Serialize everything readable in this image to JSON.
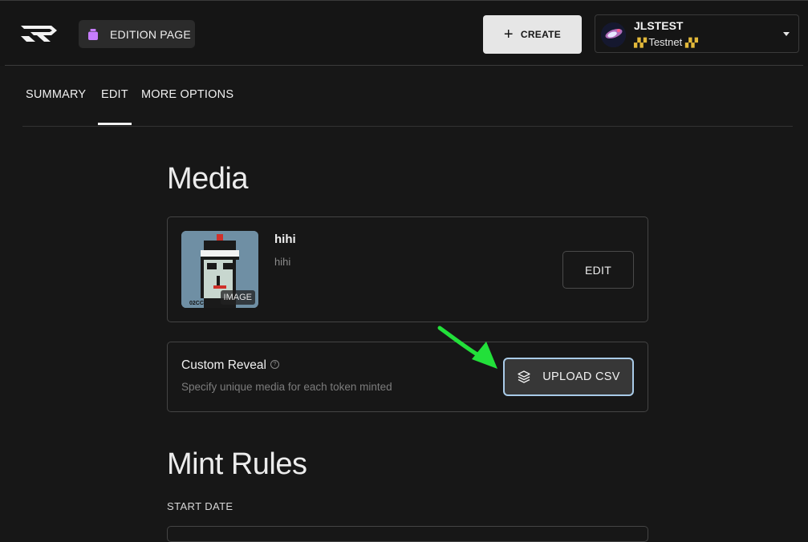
{
  "header": {
    "edition_label": "EDITION PAGE",
    "create_label": "CREATE",
    "account": {
      "name": "JLSTEST",
      "network": "Testnet"
    }
  },
  "tabs": [
    {
      "label": "SUMMARY",
      "active": false
    },
    {
      "label": "EDIT",
      "active": true
    },
    {
      "label": "MORE OPTIONS",
      "active": false
    }
  ],
  "media": {
    "section_title": "Media",
    "item": {
      "title": "hihi",
      "description": "hihi",
      "type_badge": "IMAGE",
      "thumb_tag": "02CC"
    },
    "edit_label": "EDIT"
  },
  "custom_reveal": {
    "title": "Custom Reveal",
    "description": "Specify unique media for each token minted",
    "upload_label": "UPLOAD CSV"
  },
  "mint_rules": {
    "section_title": "Mint Rules",
    "start_date_label": "START DATE"
  },
  "colors": {
    "accent_focus": "#a9cbe8",
    "annotation_arrow": "#22e03a",
    "edition_icon": "#c77dff",
    "hazard": "#e3b93a"
  }
}
